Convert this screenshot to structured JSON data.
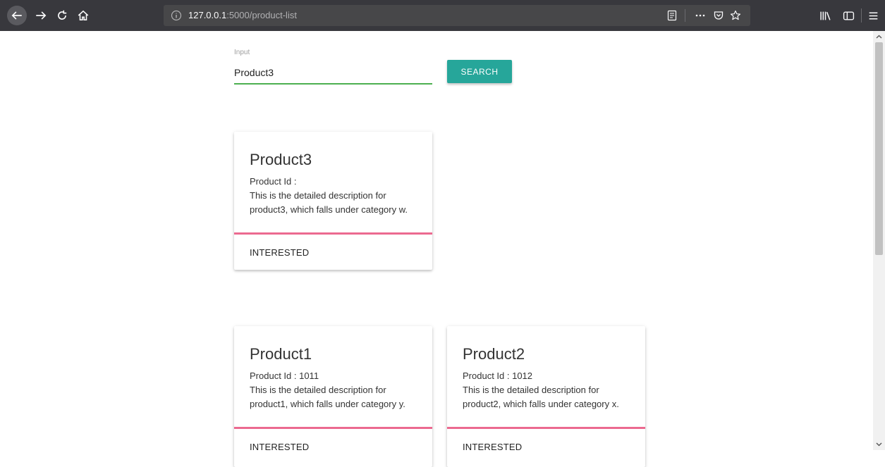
{
  "browser": {
    "url_host": "127.0.0.1",
    "url_rest": ":5000/product-list"
  },
  "search": {
    "label": "Input",
    "value": "Product3",
    "button_label": "SEARCH"
  },
  "result_card": {
    "title": "Product3",
    "product_id": "Product Id :",
    "description": "This is the detailed description for product3, which falls under category w.",
    "action": "INTERESTED"
  },
  "products": [
    {
      "title": "Product1",
      "product_id": "Product Id : 1011",
      "description": "This is the detailed description for product1, which falls under category y.",
      "action": "INTERESTED"
    },
    {
      "title": "Product2",
      "product_id": "Product Id : 1012",
      "description": "This is the detailed description for product2, which falls under category x.",
      "action": "INTERESTED"
    }
  ],
  "colors": {
    "accent_teal": "#26a69a",
    "input_underline": "#4caf50",
    "card_divider": "#ec6a90"
  }
}
